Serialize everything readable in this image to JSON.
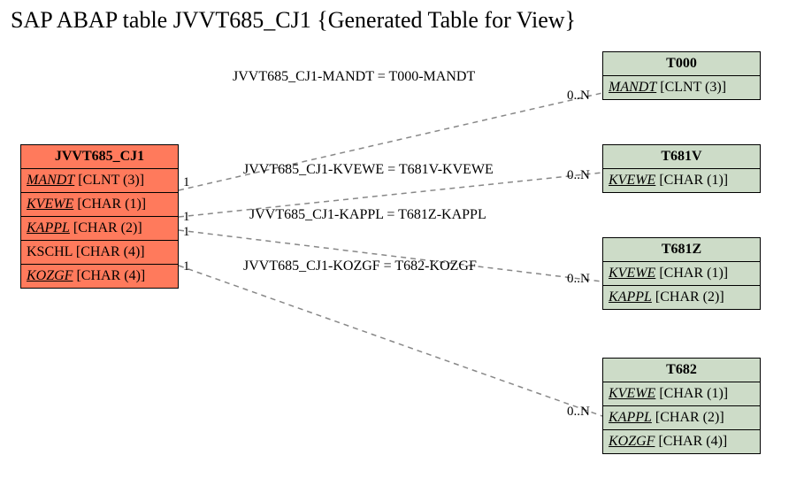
{
  "title": "SAP ABAP table JVVT685_CJ1 {Generated Table for View}",
  "entities": {
    "main": {
      "name": "JVVT685_CJ1",
      "fields": [
        {
          "label": "MANDT",
          "type": "[CLNT (3)]",
          "key": true
        },
        {
          "label": "KVEWE",
          "type": "[CHAR (1)]",
          "key": true
        },
        {
          "label": "KAPPL",
          "type": "[CHAR (2)]",
          "key": true
        },
        {
          "label": "KSCHL",
          "type": "[CHAR (4)]",
          "key": false
        },
        {
          "label": "KOZGF",
          "type": "[CHAR (4)]",
          "key": true
        }
      ]
    },
    "t000": {
      "name": "T000",
      "fields": [
        {
          "label": "MANDT",
          "type": "[CLNT (3)]",
          "key": true
        }
      ]
    },
    "t681v": {
      "name": "T681V",
      "fields": [
        {
          "label": "KVEWE",
          "type": "[CHAR (1)]",
          "key": true
        }
      ]
    },
    "t681z": {
      "name": "T681Z",
      "fields": [
        {
          "label": "KVEWE",
          "type": "[CHAR (1)]",
          "key": true
        },
        {
          "label": "KAPPL",
          "type": "[CHAR (2)]",
          "key": true
        }
      ]
    },
    "t682": {
      "name": "T682",
      "fields": [
        {
          "label": "KVEWE",
          "type": "[CHAR (1)]",
          "key": true
        },
        {
          "label": "KAPPL",
          "type": "[CHAR (2)]",
          "key": true
        },
        {
          "label": "KOZGF",
          "type": "[CHAR (4)]",
          "key": true
        }
      ]
    }
  },
  "relations": [
    {
      "label": "JVVT685_CJ1-MANDT = T000-MANDT",
      "from_card": "1",
      "to_card": "0..N"
    },
    {
      "label": "JVVT685_CJ1-KVEWE = T681V-KVEWE",
      "from_card": "1",
      "to_card": "0..N"
    },
    {
      "label": "JVVT685_CJ1-KAPPL = T681Z-KAPPL",
      "from_card": "1",
      "to_card": "0..N"
    },
    {
      "label": "JVVT685_CJ1-KOZGF = T682-KOZGF",
      "from_card": "1",
      "to_card": "0..N"
    }
  ]
}
